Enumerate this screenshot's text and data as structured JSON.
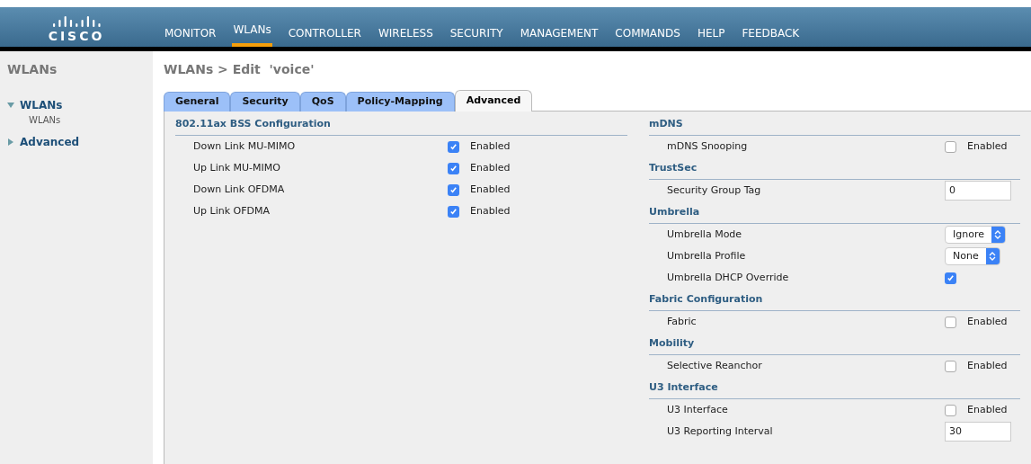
{
  "logo": "CISCO",
  "nav": [
    {
      "label": "MONITOR",
      "selected": false
    },
    {
      "label": "WLANs",
      "selected": true
    },
    {
      "label": "CONTROLLER",
      "selected": false
    },
    {
      "label": "WIRELESS",
      "selected": false
    },
    {
      "label": "SECURITY",
      "selected": false
    },
    {
      "label": "MANAGEMENT",
      "selected": false
    },
    {
      "label": "COMMANDS",
      "selected": false
    },
    {
      "label": "HELP",
      "selected": false
    },
    {
      "label": "FEEDBACK",
      "selected": false
    }
  ],
  "sidebar": {
    "title": "WLANs",
    "items": [
      {
        "label": "WLANs",
        "expanded": true,
        "children": [
          {
            "label": "WLANs"
          }
        ]
      },
      {
        "label": "Advanced",
        "expanded": false
      }
    ]
  },
  "page_title": "WLANs > Edit  'voice'",
  "tabs": [
    {
      "label": "General",
      "selected": false
    },
    {
      "label": "Security",
      "selected": false
    },
    {
      "label": "QoS",
      "selected": false
    },
    {
      "label": "Policy-Mapping",
      "selected": false
    },
    {
      "label": "Advanced",
      "selected": true
    }
  ],
  "left_sections": [
    {
      "title": "802.11ax BSS Configuration",
      "rows": [
        {
          "kind": "checkbox",
          "label": "Down Link MU-MIMO",
          "checked": true,
          "text": "Enabled"
        },
        {
          "kind": "checkbox",
          "label": "Up Link MU-MIMO",
          "checked": true,
          "text": "Enabled"
        },
        {
          "kind": "checkbox",
          "label": "Down Link OFDMA",
          "checked": true,
          "text": "Enabled"
        },
        {
          "kind": "checkbox",
          "label": "Up Link OFDMA",
          "checked": true,
          "text": "Enabled"
        }
      ]
    }
  ],
  "right_sections": [
    {
      "title": "mDNS",
      "rows": [
        {
          "kind": "checkbox",
          "label": "mDNS Snooping",
          "checked": false,
          "text": "Enabled"
        }
      ]
    },
    {
      "title": "TrustSec",
      "rows": [
        {
          "kind": "input",
          "label": "Security Group Tag",
          "value": "0"
        }
      ]
    },
    {
      "title": "Umbrella",
      "rows": [
        {
          "kind": "select",
          "label": "Umbrella Mode",
          "value": "Ignore"
        },
        {
          "kind": "select",
          "label": "Umbrella Profile",
          "value": "None"
        },
        {
          "kind": "checkbox",
          "label": "Umbrella DHCP Override",
          "checked": true
        }
      ]
    },
    {
      "title": "Fabric Configuration",
      "rows": [
        {
          "kind": "checkbox",
          "label": "Fabric",
          "checked": false,
          "text": "Enabled"
        }
      ]
    },
    {
      "title": "Mobility",
      "rows": [
        {
          "kind": "checkbox",
          "label": "Selective Reanchor",
          "checked": false,
          "text": "Enabled"
        }
      ]
    },
    {
      "title": "U3 Interface",
      "rows": [
        {
          "kind": "checkbox",
          "label": "U3 Interface",
          "checked": false,
          "text": "Enabled"
        },
        {
          "kind": "input",
          "label": "U3 Reporting Interval",
          "value": "30"
        }
      ]
    }
  ]
}
